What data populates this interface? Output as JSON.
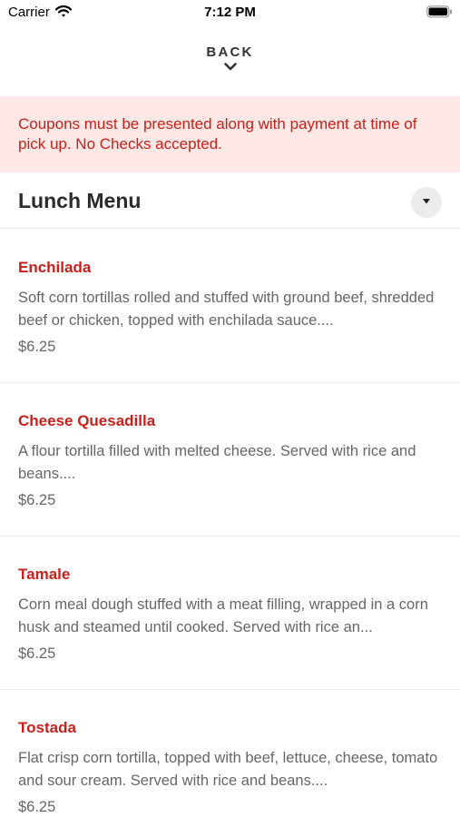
{
  "status_bar": {
    "carrier": "Carrier",
    "time": "7:12 PM",
    "icons": [
      "wifi-icon",
      "battery-icon"
    ]
  },
  "nav": {
    "back_label": "BACK",
    "back_icon": "chevron-down-icon"
  },
  "notice": {
    "text": "Coupons must be presented along with payment at time of pick up. No Checks accepted.",
    "background": "#fde8e5",
    "color": "#c8211c"
  },
  "menu": {
    "title": "Lunch Menu",
    "toggle_icon": "caret-down-icon",
    "items": [
      {
        "name": "Enchilada",
        "description": "Soft corn tortillas rolled and stuffed with ground beef, shredded beef or chicken, topped with enchilada sauce....",
        "price": "$6.25"
      },
      {
        "name": "Cheese Quesadilla",
        "description": "A flour tortilla filled with melted cheese. Served with rice and beans....",
        "price": "$6.25"
      },
      {
        "name": "Tamale",
        "description": "Corn meal dough stuffed with a meat filling, wrapped in a corn husk and steamed until cooked. Served with rice an...",
        "price": "$6.25"
      },
      {
        "name": "Tostada",
        "description": "Flat crisp corn tortilla, topped with beef, lettuce, cheese, tomato and sour cream. Served with rice and beans....",
        "price": "$6.25"
      }
    ]
  },
  "colors": {
    "accent": "#c8211c",
    "text_muted": "#666666"
  }
}
